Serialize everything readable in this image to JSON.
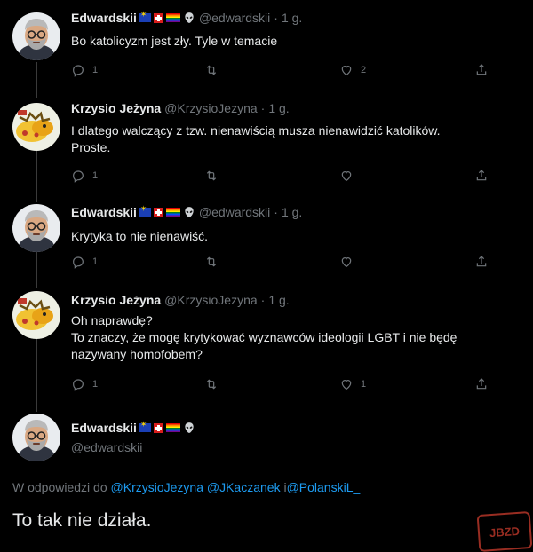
{
  "tweets": [
    {
      "name": "Edwardskii",
      "handle": "@edwardskii",
      "dot": "·",
      "time": "1 g.",
      "text": "Bo katolicyzm jest zły. Tyle w temacie",
      "reply_count": "1",
      "retweet_count": "",
      "like_count": "2"
    },
    {
      "name": "Krzysio Jeżyna",
      "handle": "@KrzysioJezyna",
      "dot": "·",
      "time": "1 g.",
      "text_lines": [
        "I dlatego walczący z tzw. nienawiścią musza nienawidzić katolików.",
        "Proste."
      ],
      "reply_count": "1",
      "retweet_count": "",
      "like_count": ""
    },
    {
      "name": "Edwardskii",
      "handle": "@edwardskii",
      "dot": "·",
      "time": "1 g.",
      "text": "Krytyka to nie nienawiść.",
      "reply_count": "1",
      "retweet_count": "",
      "like_count": ""
    },
    {
      "name": "Krzysio Jeżyna",
      "handle": "@KrzysioJezyna",
      "dot": "·",
      "time": "1 g.",
      "text_lines": [
        "Oh naprawdę?",
        "To znaczy, że mogę krytykować wyznawców ideologii LGBT i nie będę",
        "nazywany homofobem?"
      ],
      "reply_count": "1",
      "retweet_count": "",
      "like_count": "1"
    }
  ],
  "main_tweet": {
    "name": "Edwardskii",
    "handle": "@edwardskii",
    "reply_prefix": "W odpowiedzi do",
    "mentions": [
      "@KrzysioJezyna",
      "@JKaczanek",
      "@PolanskiL_"
    ],
    "mention_sep_1": " ",
    "mention_sep_2": " i",
    "text": "To tak nie działa."
  },
  "watermark": "JBZD",
  "colors": {
    "background": "#000000",
    "text": "#e7e9ea",
    "muted": "#71767b",
    "accent": "#1d9bf0"
  },
  "icons": [
    "reply-icon",
    "retweet-icon",
    "like-icon",
    "share-icon",
    "alien-icon",
    "eu-flag-icon",
    "swiss-flag-icon",
    "rainbow-flag-icon"
  ]
}
